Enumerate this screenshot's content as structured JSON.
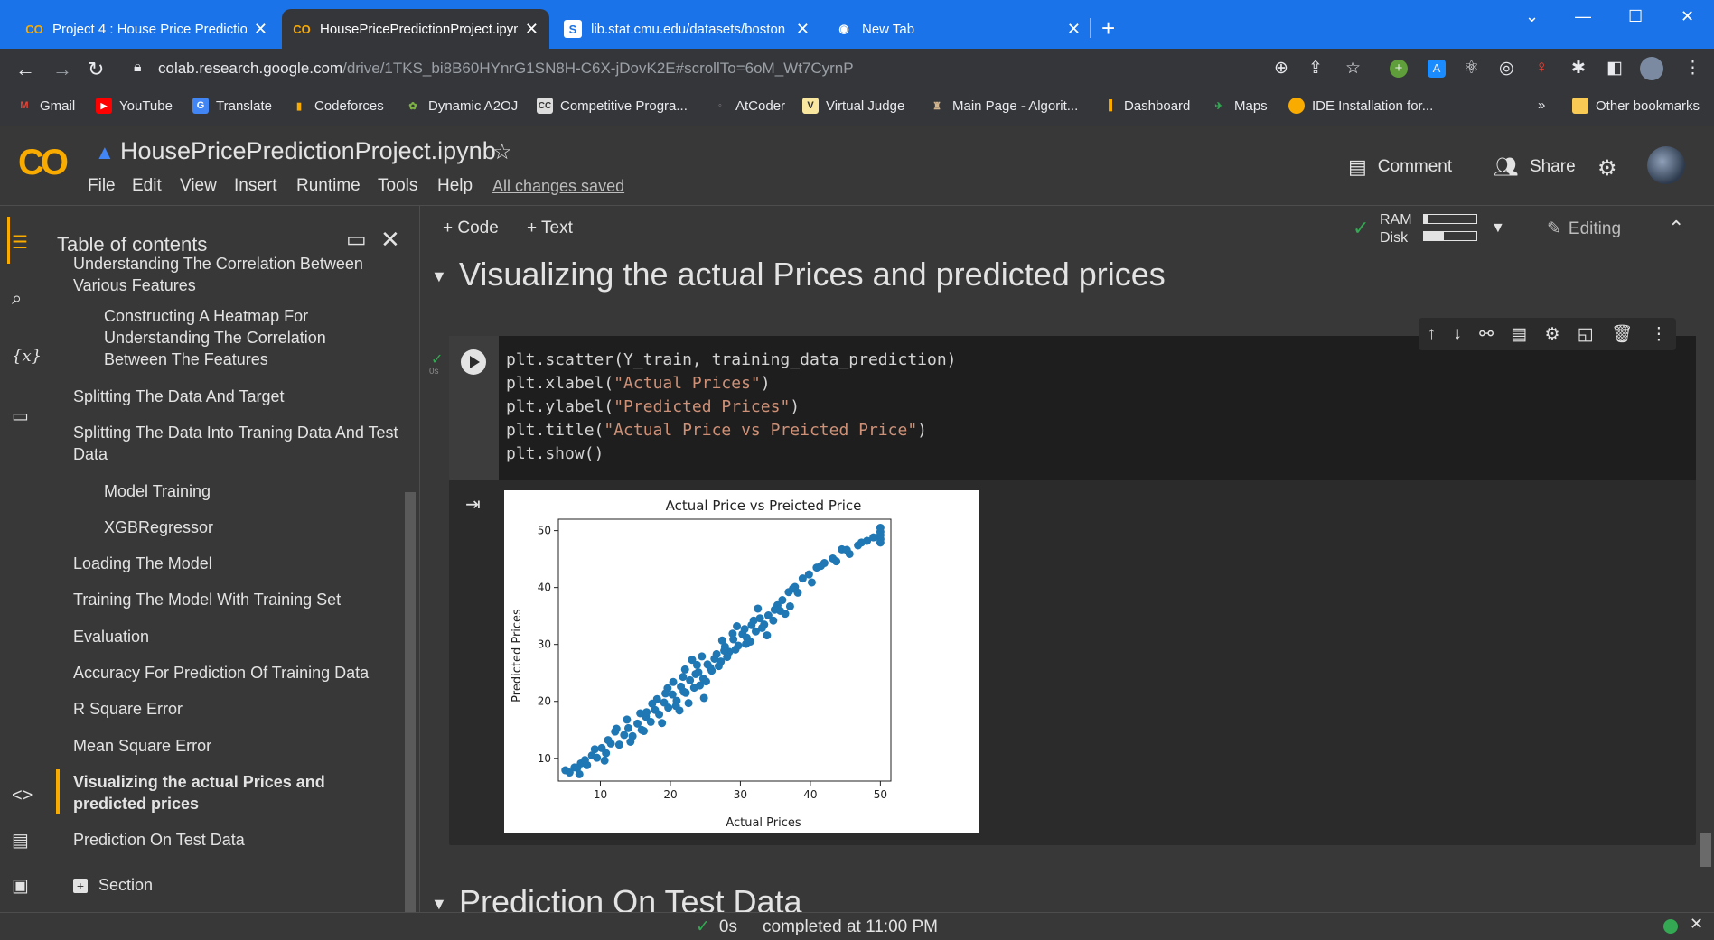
{
  "browser": {
    "tabs": [
      {
        "title": "Project 4 : House Price Prediction",
        "active": false
      },
      {
        "title": "HousePricePredictionProject.ipynb",
        "active": true
      },
      {
        "title": "lib.stat.cmu.edu/datasets/boston",
        "active": false
      },
      {
        "title": "New Tab",
        "active": false
      }
    ],
    "url_host": "colab.research.google.com",
    "url_path": "/drive/1TKS_bi8B60HYnrG1SN8H-C6X-jDovK2E#scrollTo=6oM_Wt7CyrnP",
    "bookmarks": [
      "Gmail",
      "YouTube",
      "Translate",
      "Codeforces",
      "Dynamic A2OJ",
      "Competitive Progra...",
      "AtCoder",
      "Virtual Judge",
      "Main Page - Algorit...",
      "Dashboard",
      "Maps",
      "IDE Installation for..."
    ],
    "bookmarks_overflow": "»",
    "other_bookmarks": "Other bookmarks"
  },
  "colab": {
    "logo": "CO",
    "notebook_title": "HousePricePredictionProject.ipynb",
    "menu": [
      "File",
      "Edit",
      "View",
      "Insert",
      "Runtime",
      "Tools",
      "Help"
    ],
    "saved_status": "All changes saved",
    "comment_label": "Comment",
    "share_label": "Share",
    "add_code": "+ Code",
    "add_text": "+ Text",
    "ram_label": "RAM",
    "disk_label": "Disk",
    "editing_label": "Editing"
  },
  "toc": {
    "header": "Table of contents",
    "items": [
      {
        "label": "Understanding The Correlation Between Various Features",
        "level": 1
      },
      {
        "label": "Constructing A Heatmap For Understanding The Correlation Between The Features",
        "level": 2
      },
      {
        "label": "Splitting The Data And Target",
        "level": 1
      },
      {
        "label": "Splitting The Data Into Traning Data And Test Data",
        "level": 1
      },
      {
        "label": "Model Training",
        "level": 2
      },
      {
        "label": "XGBRegressor",
        "level": 2
      },
      {
        "label": "Loading The Model",
        "level": 1
      },
      {
        "label": "Training The Model With Training Set",
        "level": 1
      },
      {
        "label": "Evaluation",
        "level": 1
      },
      {
        "label": "Accuracy For Prediction Of Training Data",
        "level": 1
      },
      {
        "label": "R Square Error",
        "level": 1
      },
      {
        "label": "Mean Square Error",
        "level": 1
      },
      {
        "label": "Visualizing the actual Prices and predicted prices",
        "level": 1,
        "active": true
      },
      {
        "label": "Prediction On Test Data",
        "level": 1
      }
    ],
    "add_section": "Section"
  },
  "main": {
    "section_heading": "Visualizing the actual Prices and predicted prices",
    "next_heading": "Prediction On Test Data",
    "exec_time": "0s",
    "code_lines": [
      "plt.scatter(Y_train, training_data_prediction)",
      "plt.xlabel(\"Actual Prices\")",
      "plt.ylabel(\"Predicted Prices\")",
      "plt.title(\"Actual Price vs Preicted Price\")",
      "plt.show()"
    ]
  },
  "chart_data": {
    "type": "scatter",
    "title": "Actual Price vs Preicted Price",
    "xlabel": "Actual Prices",
    "ylabel": "Predicted Prices",
    "xlim": [
      4,
      51.5
    ],
    "ylim": [
      6,
      52
    ],
    "xticks": [
      10,
      20,
      30,
      40,
      50
    ],
    "yticks": [
      10,
      20,
      30,
      40,
      50
    ],
    "color": "#1f77b4",
    "points": [
      [
        5.0,
        7.9
      ],
      [
        5.6,
        7.5
      ],
      [
        6.3,
        8.4
      ],
      [
        7.0,
        7.2
      ],
      [
        7.2,
        9.1
      ],
      [
        8.1,
        8.8
      ],
      [
        8.8,
        10.5
      ],
      [
        9.5,
        10.1
      ],
      [
        10.2,
        11.8
      ],
      [
        10.8,
        10.9
      ],
      [
        11.5,
        12.6
      ],
      [
        12.1,
        14.7
      ],
      [
        12.7,
        12.4
      ],
      [
        13.4,
        14.1
      ],
      [
        14.0,
        15.3
      ],
      [
        14.6,
        13.9
      ],
      [
        15.3,
        16.1
      ],
      [
        15.9,
        15.0
      ],
      [
        16.5,
        17.3
      ],
      [
        17.2,
        16.4
      ],
      [
        17.8,
        18.5
      ],
      [
        18.4,
        17.7
      ],
      [
        19.1,
        19.8
      ],
      [
        19.7,
        18.9
      ],
      [
        20.3,
        21.2
      ],
      [
        20.9,
        20.1
      ],
      [
        21.5,
        22.6
      ],
      [
        22.2,
        21.5
      ],
      [
        22.8,
        23.7
      ],
      [
        23.4,
        22.4
      ],
      [
        24.0,
        25.1
      ],
      [
        24.7,
        24.0
      ],
      [
        25.3,
        26.5
      ],
      [
        25.9,
        25.4
      ],
      [
        26.6,
        28.3
      ],
      [
        27.2,
        27.0
      ],
      [
        27.8,
        29.6
      ],
      [
        28.4,
        28.7
      ],
      [
        29.0,
        30.9
      ],
      [
        29.7,
        29.8
      ],
      [
        30.3,
        31.8
      ],
      [
        30.9,
        31.2
      ],
      [
        31.6,
        33.4
      ],
      [
        32.2,
        32.3
      ],
      [
        32.8,
        34.6
      ],
      [
        33.4,
        33.5
      ],
      [
        34.0,
        35.1
      ],
      [
        34.7,
        34.2
      ],
      [
        35.3,
        36.9
      ],
      [
        36.0,
        37.8
      ],
      [
        36.9,
        39.2
      ],
      [
        37.8,
        40.1
      ],
      [
        38.9,
        41.6
      ],
      [
        39.8,
        42.3
      ],
      [
        40.9,
        43.5
      ],
      [
        42.0,
        44.3
      ],
      [
        43.2,
        45.1
      ],
      [
        44.5,
        46.7
      ],
      [
        45.6,
        45.9
      ],
      [
        46.8,
        47.4
      ],
      [
        48.1,
        48.2
      ],
      [
        49.0,
        48.8
      ],
      [
        50.0,
        47.9
      ],
      [
        50.0,
        48.5
      ],
      [
        50.0,
        49.2
      ],
      [
        50.0,
        49.8
      ],
      [
        50.0,
        50.5
      ],
      [
        23.1,
        27.3
      ],
      [
        22.6,
        19.7
      ],
      [
        21.3,
        18.4
      ],
      [
        24.8,
        20.6
      ],
      [
        19.6,
        22.3
      ],
      [
        17.4,
        19.6
      ],
      [
        15.7,
        17.9
      ],
      [
        13.8,
        16.8
      ],
      [
        12.3,
        15.2
      ],
      [
        18.8,
        16.2
      ],
      [
        16.6,
        18.1
      ],
      [
        20.4,
        23.4
      ],
      [
        21.8,
        24.3
      ],
      [
        22.1,
        25.6
      ],
      [
        23.8,
        26.4
      ],
      [
        24.5,
        27.9
      ],
      [
        25.1,
        23.5
      ],
      [
        26.3,
        27.5
      ],
      [
        27.4,
        30.7
      ],
      [
        28.1,
        27.8
      ],
      [
        28.9,
        31.9
      ],
      [
        29.5,
        33.2
      ],
      [
        30.6,
        32.7
      ],
      [
        31.9,
        34.2
      ],
      [
        32.5,
        36.3
      ],
      [
        33.8,
        31.6
      ],
      [
        34.9,
        36.1
      ],
      [
        36.4,
        35.4
      ],
      [
        37.5,
        39.8
      ],
      [
        38.2,
        39.1
      ],
      [
        40.2,
        40.9
      ],
      [
        41.5,
        43.8
      ],
      [
        43.7,
        44.6
      ],
      [
        45.2,
        46.6
      ],
      [
        47.3,
        47.9
      ],
      [
        11.1,
        13.2
      ],
      [
        9.2,
        11.6
      ],
      [
        7.8,
        9.7
      ],
      [
        6.7,
        8.3
      ],
      [
        10.6,
        9.6
      ],
      [
        14.3,
        12.9
      ],
      [
        16.2,
        14.8
      ],
      [
        18.1,
        20.4
      ],
      [
        19.3,
        21.4
      ],
      [
        20.8,
        19.2
      ],
      [
        21.9,
        21.7
      ],
      [
        23.6,
        24.8
      ],
      [
        24.2,
        22.8
      ],
      [
        25.7,
        25.9
      ],
      [
        26.9,
        26.2
      ],
      [
        27.7,
        28.9
      ],
      [
        29.3,
        29.1
      ],
      [
        30.8,
        30.1
      ],
      [
        31.4,
        30.5
      ],
      [
        33.1,
        32.9
      ],
      [
        35.7,
        35.9
      ],
      [
        37.1,
        36.7
      ]
    ]
  },
  "statusbar": {
    "check": "✓",
    "time": "0s",
    "message": "completed at 11:00 PM"
  }
}
